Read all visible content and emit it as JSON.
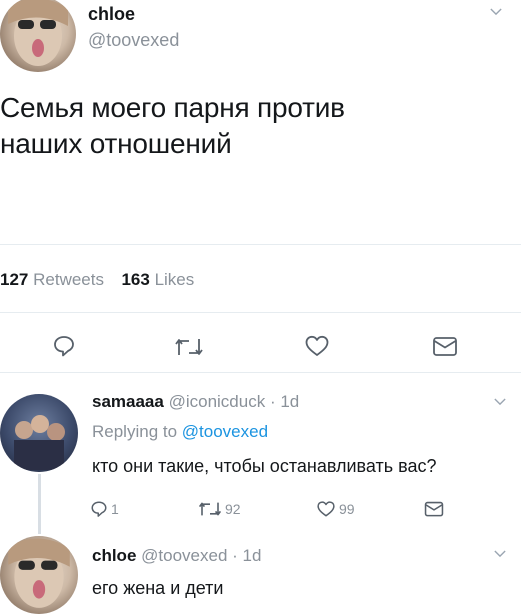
{
  "main_tweet": {
    "display_name": "chloe",
    "handle": "@toovexed",
    "text_line1": "Семья моего парня против",
    "text_line2": "наших отношений",
    "retweets_count": "127",
    "retweets_label": "Retweets",
    "likes_count": "163",
    "likes_label": "Likes"
  },
  "reply1": {
    "display_name": "samaaaa",
    "handle": "@iconicduck",
    "time": "· 1d",
    "replying_label": "Replying to",
    "replying_handle": "@toovexed",
    "text": "кто они такие, чтобы останавливать вас?",
    "reply_count": "1",
    "retweet_count": "92",
    "like_count": "99"
  },
  "reply2": {
    "display_name": "chloe",
    "handle": "@toovexed",
    "time": "· 1d",
    "text": "его жена и дети"
  },
  "colors": {
    "text": "#14171a",
    "muted": "#8a9199",
    "link": "#1c94e0",
    "divider": "#e6ecf0"
  },
  "icons": [
    "reply-icon",
    "retweet-icon",
    "like-icon",
    "message-icon",
    "chevron-down-icon"
  ]
}
